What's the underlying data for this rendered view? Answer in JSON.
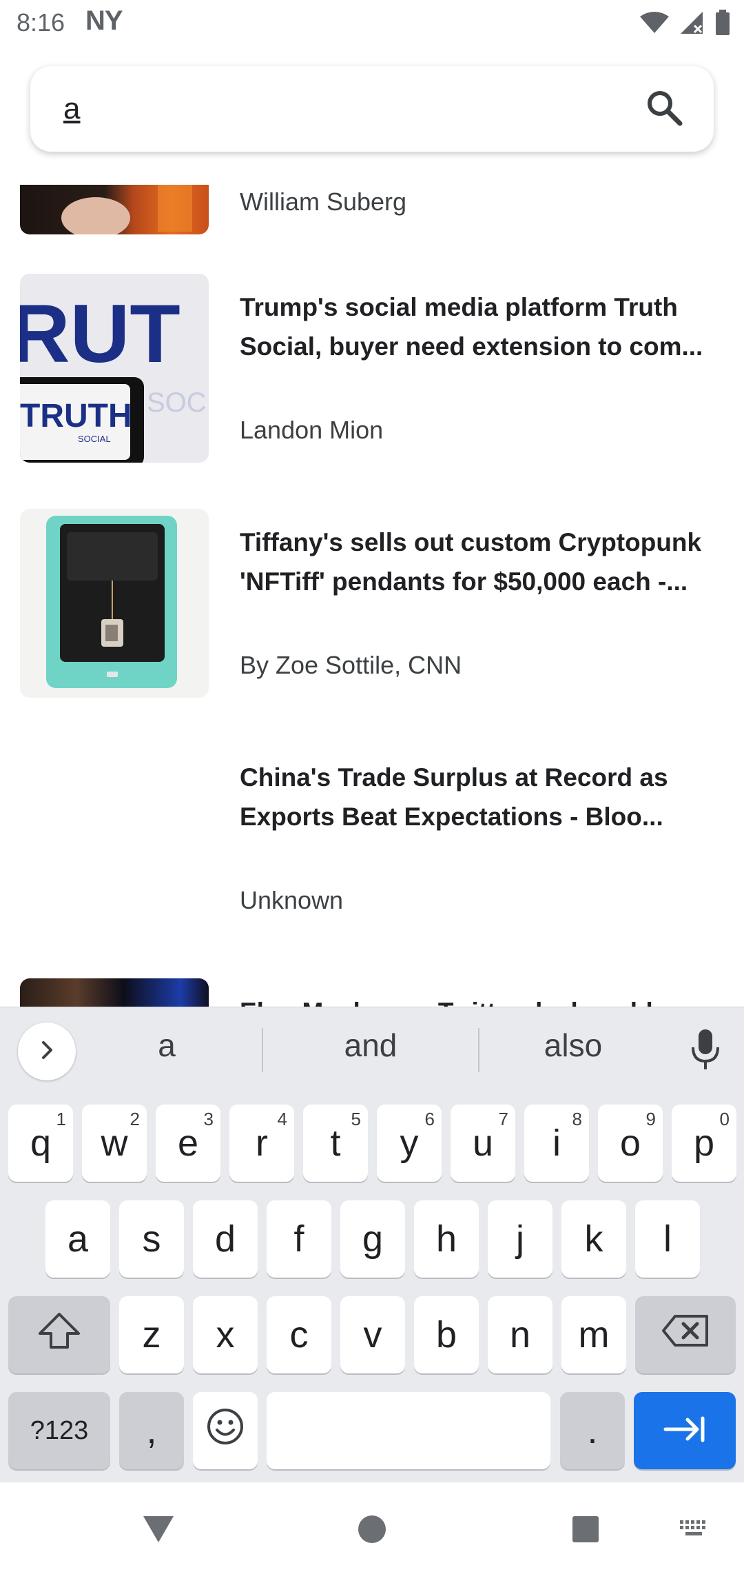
{
  "status_bar": {
    "time": "8:16",
    "carrier": "NY",
    "icons": [
      "wifi-icon",
      "signal-icon",
      "battery-icon"
    ]
  },
  "search": {
    "value": "a",
    "placeholder": "",
    "button_icon": "search-icon"
  },
  "articles": [
    {
      "title": "",
      "author": "William Suberg",
      "has_thumbnail": true,
      "partially_visible": "top"
    },
    {
      "title": "Trump's social media platform Truth Social, buyer need extension to com...",
      "author": "Landon Mion",
      "has_thumbnail": true
    },
    {
      "title": "Tiffany's sells out custom Cryptopunk 'NFTiff' pendants for $50,000 each -...",
      "author": "By Zoe Sottile, CNN",
      "has_thumbnail": true
    },
    {
      "title": "China's Trade Surplus at Record as Exports Beat Expectations - Bloo...",
      "author": "Unknown",
      "has_thumbnail": false
    },
    {
      "title": "Elon Musk says Twitter deal could go",
      "author": "",
      "has_thumbnail": true,
      "partially_visible": "bottom"
    }
  ],
  "thumbnail_texts": {
    "truth_big": "RUT",
    "truth_logo": "TRUTH",
    "truth_sub": "SOCIAL",
    "truth_soc": "SOC"
  },
  "keyboard": {
    "suggestions": [
      "a",
      "and",
      "also"
    ],
    "row1": [
      {
        "key": "q",
        "hint": "1"
      },
      {
        "key": "w",
        "hint": "2"
      },
      {
        "key": "e",
        "hint": "3"
      },
      {
        "key": "r",
        "hint": "4"
      },
      {
        "key": "t",
        "hint": "5"
      },
      {
        "key": "y",
        "hint": "6"
      },
      {
        "key": "u",
        "hint": "7"
      },
      {
        "key": "i",
        "hint": "8"
      },
      {
        "key": "o",
        "hint": "9"
      },
      {
        "key": "p",
        "hint": "0"
      }
    ],
    "row2": [
      "a",
      "s",
      "d",
      "f",
      "g",
      "h",
      "j",
      "k",
      "l"
    ],
    "row3": [
      "z",
      "x",
      "c",
      "v",
      "b",
      "n",
      "m"
    ],
    "symbols_label": "?123",
    "comma": ",",
    "period": ".",
    "enter_color": "#1a73e8"
  },
  "nav_bar": {
    "icons": [
      "back-icon",
      "home-icon",
      "recents-icon",
      "keyboard-switch-icon"
    ]
  }
}
